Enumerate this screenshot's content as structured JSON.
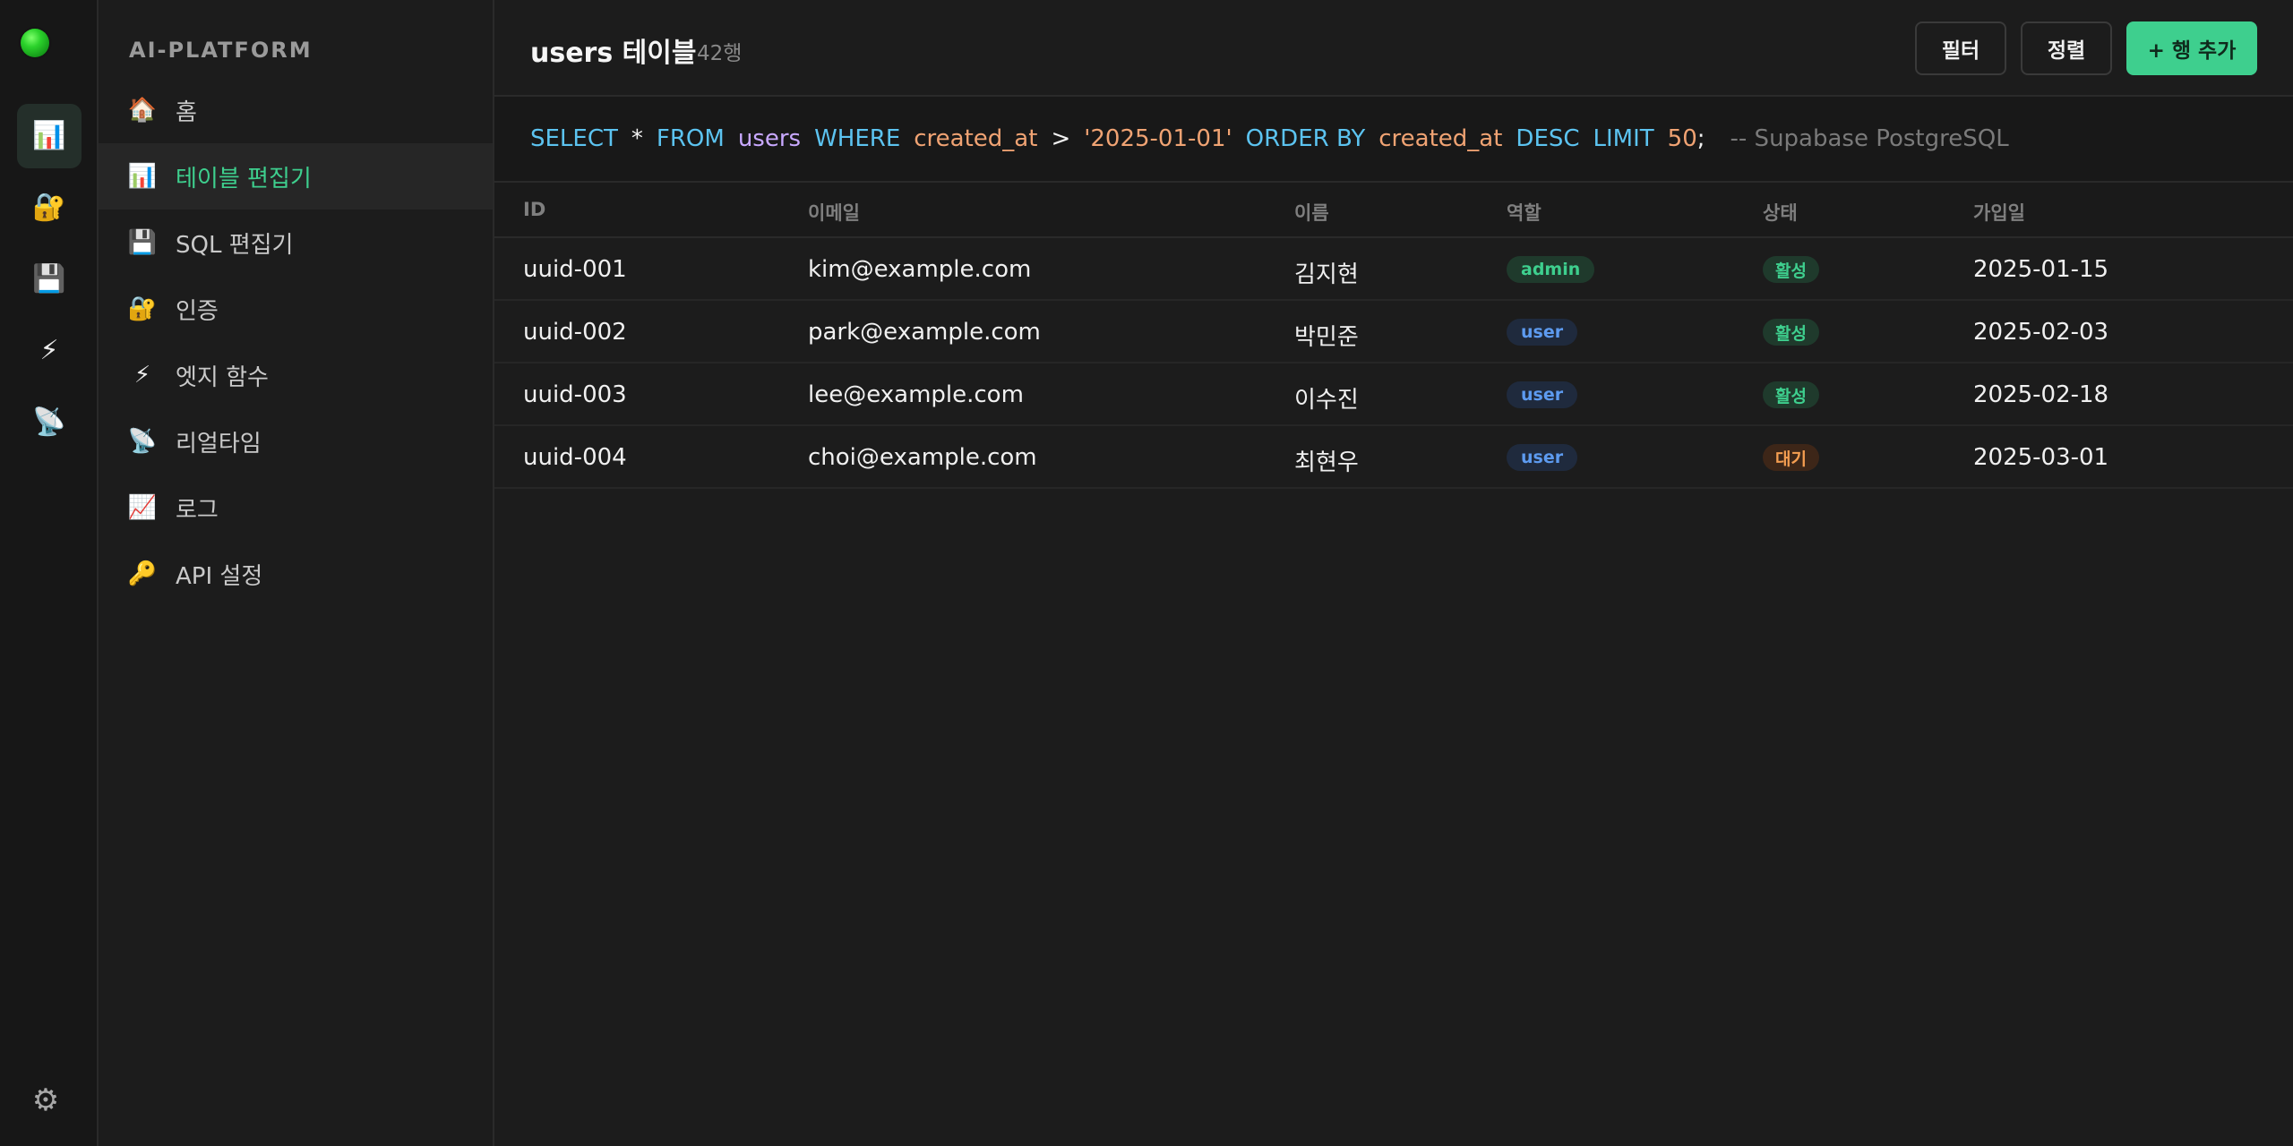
{
  "rail": {
    "items": [
      {
        "icon": "📊",
        "name": "table-icon",
        "active": true
      },
      {
        "icon": "🔐",
        "name": "lock-icon",
        "active": false
      },
      {
        "icon": "💾",
        "name": "disk-icon",
        "active": false
      },
      {
        "icon": "⚡",
        "name": "lightning-icon",
        "active": false
      },
      {
        "icon": "📡",
        "name": "satellite-icon",
        "active": false
      }
    ],
    "settings_icon": "⚙"
  },
  "sidebar": {
    "brand": "AI-PLATFORM",
    "items": [
      {
        "icon": "🏠",
        "label": "홈"
      },
      {
        "icon": "📊",
        "label": "테이블 편집기"
      },
      {
        "icon": "💾",
        "label": "SQL 편집기"
      },
      {
        "icon": "🔐",
        "label": "인증"
      },
      {
        "icon": "⚡",
        "label": "엣지 함수"
      },
      {
        "icon": "📡",
        "label": "리얼타임"
      },
      {
        "icon": "📈",
        "label": "로그"
      },
      {
        "icon": "🔑",
        "label": "API 설정"
      }
    ],
    "active_index": 1
  },
  "header": {
    "title": "users 테이블",
    "row_count": "42행",
    "filter_label": "필터",
    "sort_label": "정렬",
    "add_row_label": "+ 행 추가"
  },
  "sql": {
    "tokens": [
      {
        "t": "SELECT",
        "c": "kw"
      },
      {
        "t": "*",
        "c": "op"
      },
      {
        "t": "FROM",
        "c": "kw"
      },
      {
        "t": "users",
        "c": "tbl"
      },
      {
        "t": "WHERE",
        "c": "kw"
      },
      {
        "t": "created_at",
        "c": "col"
      },
      {
        "t": ">",
        "c": "op"
      },
      {
        "t": "'2025-01-01'",
        "c": "str"
      },
      {
        "t": "ORDER BY",
        "c": "kw"
      },
      {
        "t": "created_at",
        "c": "col"
      },
      {
        "t": "DESC",
        "c": "kw"
      },
      {
        "t": "LIMIT",
        "c": "kw"
      },
      {
        "t": "50",
        "c": "num"
      },
      {
        "t": ";",
        "c": "op"
      },
      {
        "t": "-- Supabase PostgreSQL",
        "c": "cmt"
      }
    ]
  },
  "table": {
    "columns": [
      "ID",
      "이메일",
      "이름",
      "역할",
      "상태",
      "가입일"
    ],
    "rows": [
      {
        "id": "uuid-001",
        "email": "kim@example.com",
        "name": "김지현",
        "role": "admin",
        "status": "활성",
        "joined": "2025-01-15"
      },
      {
        "id": "uuid-002",
        "email": "park@example.com",
        "name": "박민준",
        "role": "user",
        "status": "활성",
        "joined": "2025-02-03"
      },
      {
        "id": "uuid-003",
        "email": "lee@example.com",
        "name": "이수진",
        "role": "user",
        "status": "활성",
        "joined": "2025-02-18"
      },
      {
        "id": "uuid-004",
        "email": "choi@example.com",
        "name": "최현우",
        "role": "user",
        "status": "대기",
        "joined": "2025-03-01"
      }
    ]
  },
  "colors": {
    "accent": "#3ecf8e",
    "background": "#1c1c1c",
    "user_badge": "#5d9bf0",
    "pending_badge": "#f59e51"
  }
}
